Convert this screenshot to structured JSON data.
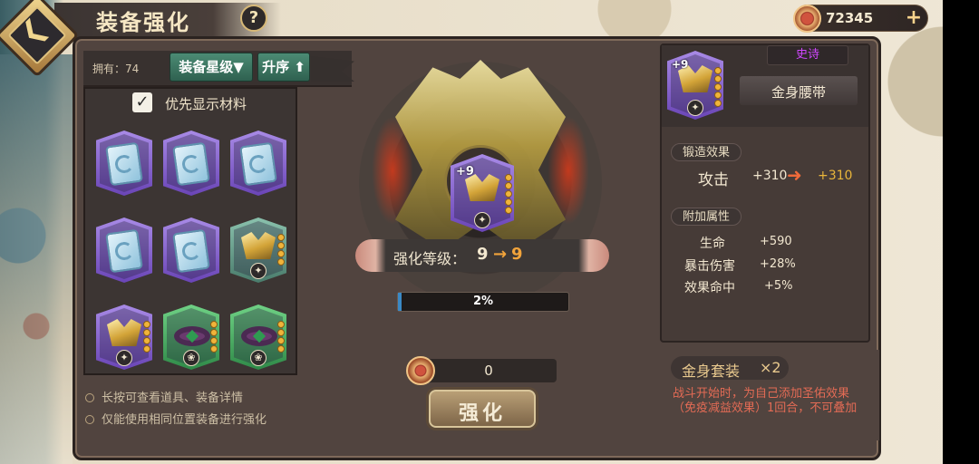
{
  "header": {
    "title": "装备强化",
    "help_icon": "?",
    "back_icon": "back-arrow-icon"
  },
  "currency": {
    "amount": "72345",
    "plus": "+"
  },
  "inventory": {
    "owned_text": "拥有：74",
    "sort_star_label": "装备星级▼",
    "sort_order_label": "升序 ⬆",
    "prioritize_label": "优先显示材料",
    "prioritize_checked": true
  },
  "tips": [
    "长按可查看道具、装备详情",
    "仅能使用相同位置装备进行强化"
  ],
  "enhance": {
    "level_label": "强化等级：",
    "level_from": "9",
    "arrow": "→",
    "level_to": "9",
    "progress_text": "2%",
    "progress_value": 0.02,
    "cost": "0",
    "button_label": "强化",
    "center_plus": "+9"
  },
  "item": {
    "rarity": "史诗",
    "name": "金身腰带",
    "plus": "+9",
    "forge_label": "锻造效果",
    "attack_name": "攻击",
    "attack_current": "+310",
    "attack_next": "+310",
    "extra_label": "附加属性",
    "stats": [
      {
        "name": "生命",
        "value": "+590"
      },
      {
        "name": "暴击伤害",
        "value": "+28%"
      },
      {
        "name": "效果命中",
        "value": "+5%"
      }
    ]
  },
  "set": {
    "name": "金身套装",
    "count": "×2",
    "description": "战斗开始时，为自己添加圣佑效果（免疫减益效果）1回合，不可叠加"
  }
}
